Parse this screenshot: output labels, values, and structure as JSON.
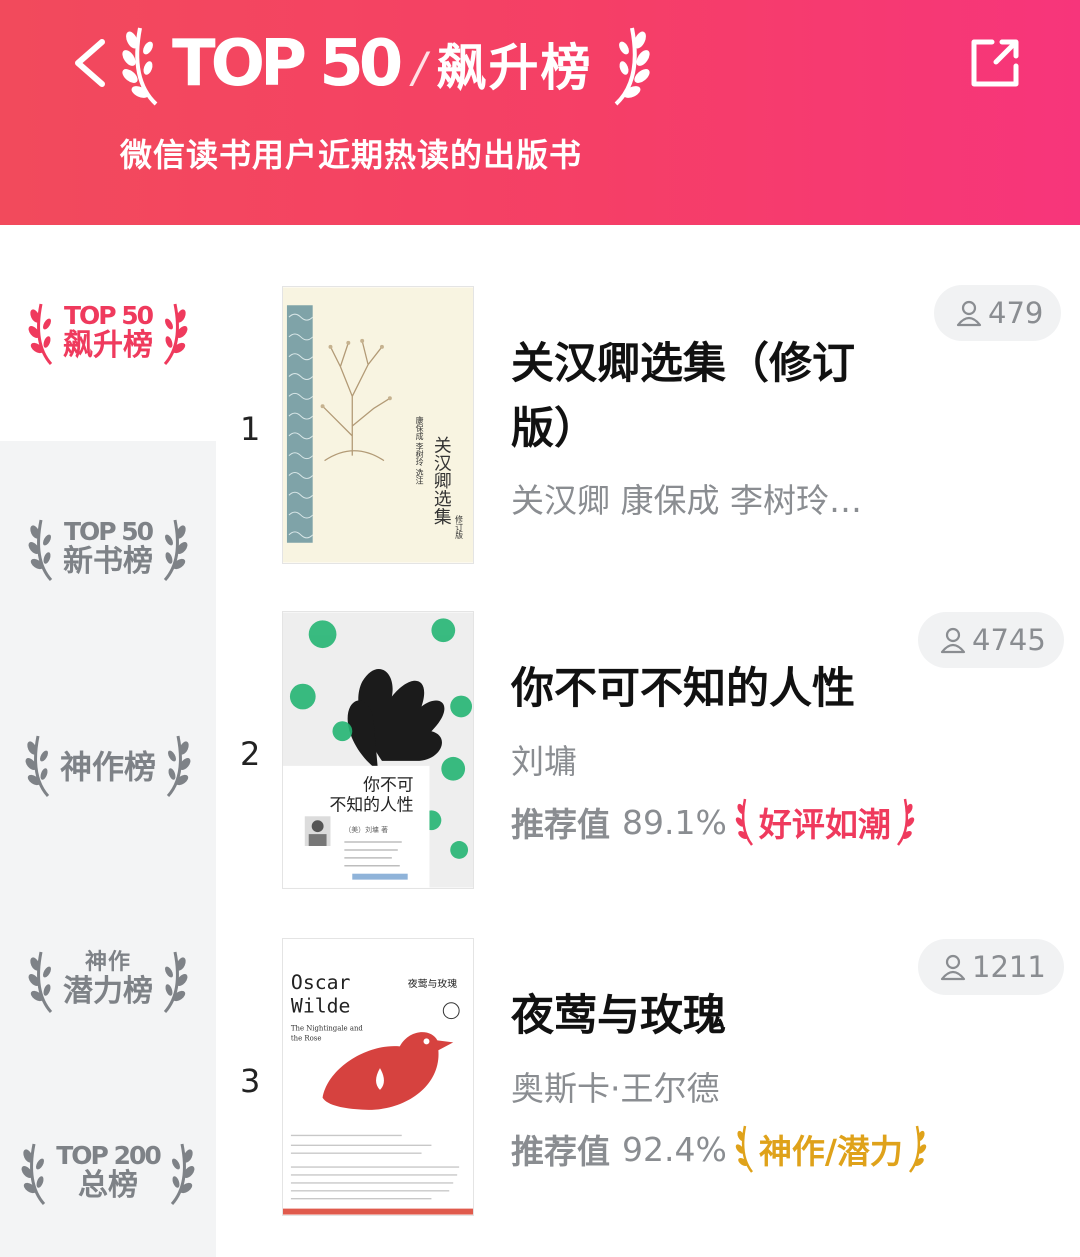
{
  "header": {
    "brand": "TOP 50",
    "separator": "/",
    "title": "飙升榜",
    "subtitle": "微信读书用户近期热读的出版书",
    "back_icon": "chevron-left-icon",
    "share_icon": "external-share-icon",
    "gradient": [
      "#f24a5c",
      "#f7357b"
    ]
  },
  "sidebar": {
    "items": [
      {
        "top": "TOP 50",
        "bottom": "飙升榜",
        "active": true
      },
      {
        "top": "TOP 50",
        "bottom": "新书榜",
        "active": false
      },
      {
        "label": "神作榜",
        "active": false
      },
      {
        "top": "神作",
        "bottom": "潜力榜",
        "active": false
      },
      {
        "top": "TOP 200",
        "bottom": "总榜",
        "active": false
      }
    ]
  },
  "books": [
    {
      "rank": "1",
      "title": "关汉卿选集（修订版）",
      "author": "关汉卿 康保成 李树玲…",
      "readers": "479",
      "cover_title": "关汉卿选集",
      "cover_subtitle": "修订版",
      "cover_editors": "康保成 李树玲 选注"
    },
    {
      "rank": "2",
      "title": "你不可不知的人性",
      "author": "刘墉",
      "rec_label": "推荐值",
      "rec_value": "89.1%",
      "tag": "好评如潮",
      "tag_color": "#ef3a5d",
      "readers": "4745",
      "cover_title_line1": "你不可",
      "cover_title_line2": "不知的人性",
      "cover_author": "（美）刘墉 著"
    },
    {
      "rank": "3",
      "title": "夜莺与玫瑰",
      "author": "奥斯卡·王尔德",
      "rec_label": "推荐值",
      "rec_value": "92.4%",
      "tag": "神作/潜力",
      "tag_color": "#dfa21a",
      "readers": "1211",
      "cover_en_line1": "Oscar",
      "cover_en_line2": "Wilde",
      "cover_cn": "夜莺与玫瑰",
      "cover_sub1": "The Nightingale and",
      "cover_sub2": "the Rose"
    }
  ]
}
